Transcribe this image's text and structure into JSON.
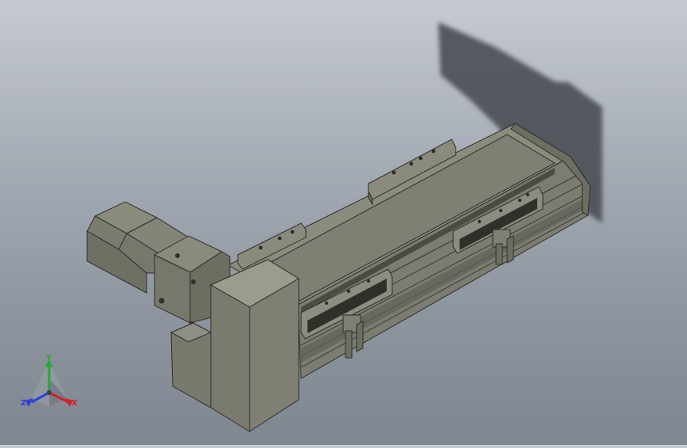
{
  "viewport": {
    "background_top": "#c5cad2",
    "background_bottom": "#7f8690",
    "model_color": "#7d7e70",
    "shadow_color": "#4b4f55"
  },
  "triad": {
    "x_label": "X",
    "y_label": "Y",
    "z_label": "Z",
    "x_color": "#d0202a",
    "y_color": "#2aa638",
    "z_color": "#2b3fd6"
  }
}
